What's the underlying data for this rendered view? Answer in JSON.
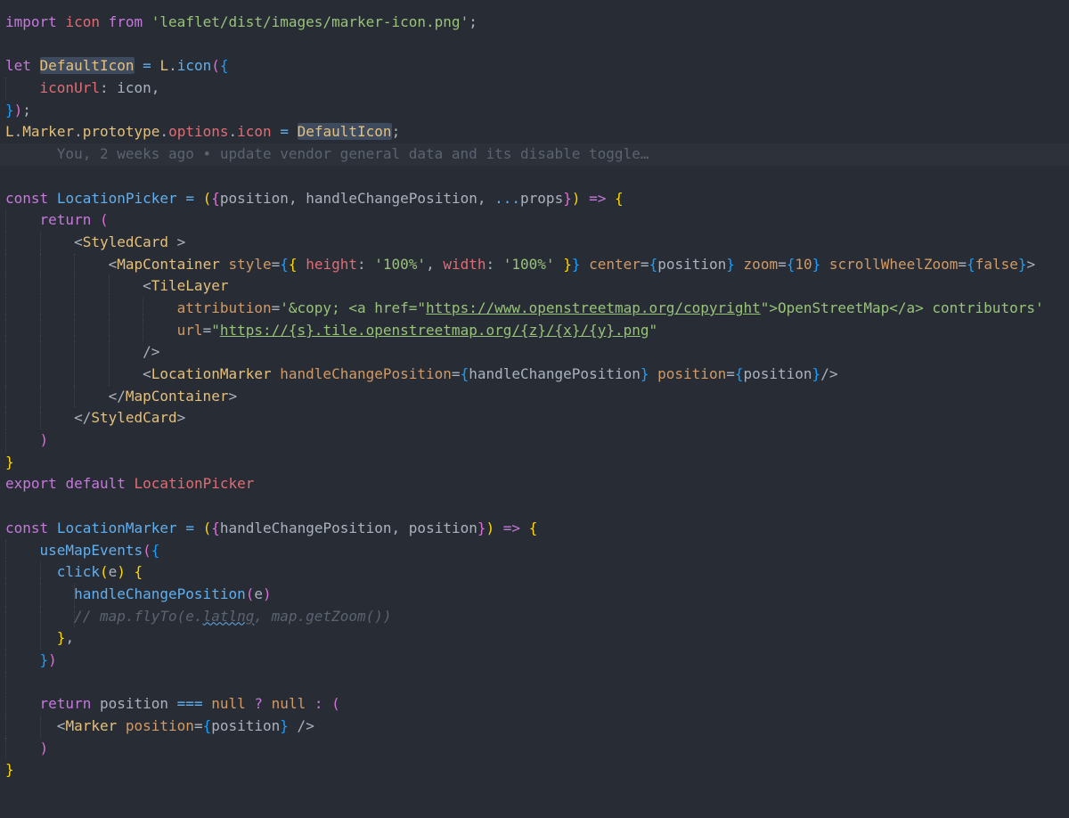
{
  "theme": {
    "background": "#282c34",
    "keyword": "#c678dd",
    "string": "#98c379",
    "function": "#61afef",
    "variable": "#e06c75",
    "type": "#e5c07b",
    "number": "#d19a66",
    "punctuation": "#abb2bf",
    "comment": "#5c6370",
    "bracket_yellow": "#ffd700",
    "bracket_purple": "#da70d6",
    "bracket_blue": "#179fff"
  },
  "code": {
    "lines": [
      {
        "indent": 0,
        "tokens": [
          {
            "t": "import",
            "c": "keyword"
          },
          {
            "t": " "
          },
          {
            "t": "icon",
            "c": "variable"
          },
          {
            "t": " "
          },
          {
            "t": "from",
            "c": "keyword"
          },
          {
            "t": " "
          },
          {
            "t": "'leaflet/dist/images/marker-icon.png'",
            "c": "string"
          },
          {
            "t": ";",
            "c": "punctuation"
          }
        ]
      },
      {
        "indent": 0,
        "tokens": []
      },
      {
        "indent": 0,
        "tokens": [
          {
            "t": "let",
            "c": "keyword"
          },
          {
            "t": " "
          },
          {
            "t": "DefaultIcon",
            "c": "type",
            "sel": true
          },
          {
            "t": " "
          },
          {
            "t": "=",
            "c": "function"
          },
          {
            "t": " "
          },
          {
            "t": "L",
            "c": "type"
          },
          {
            "t": ".",
            "c": "punctuation"
          },
          {
            "t": "icon",
            "c": "function"
          },
          {
            "t": "(",
            "c": "bracket_purple"
          },
          {
            "t": "{",
            "c": "bracket_blue"
          }
        ]
      },
      {
        "indent": 1,
        "tokens": [
          {
            "t": "    "
          },
          {
            "t": "iconUrl",
            "c": "variable"
          },
          {
            "t": ": ",
            "c": "punctuation"
          },
          {
            "t": "icon",
            "c": "punctuation"
          },
          {
            "t": ",",
            "c": "punctuation"
          }
        ]
      },
      {
        "indent": 0,
        "tokens": [
          {
            "t": "}",
            "c": "bracket_blue"
          },
          {
            "t": ")",
            "c": "bracket_purple"
          },
          {
            "t": ";",
            "c": "punctuation"
          }
        ]
      },
      {
        "indent": 0,
        "tokens": [
          {
            "t": "L",
            "c": "type"
          },
          {
            "t": ".",
            "c": "punctuation"
          },
          {
            "t": "Marker",
            "c": "type"
          },
          {
            "t": ".",
            "c": "punctuation"
          },
          {
            "t": "prototype",
            "c": "type"
          },
          {
            "t": ".",
            "c": "punctuation"
          },
          {
            "t": "options",
            "c": "variable"
          },
          {
            "t": ".",
            "c": "punctuation"
          },
          {
            "t": "icon",
            "c": "variable"
          },
          {
            "t": " "
          },
          {
            "t": "=",
            "c": "function"
          },
          {
            "t": " "
          },
          {
            "t": "DefaultIcon",
            "c": "type",
            "sel": true
          },
          {
            "t": ";",
            "c": "punctuation"
          }
        ]
      },
      {
        "indent": 0,
        "blame": true,
        "tokens": [
          {
            "t": "      "
          },
          {
            "t": "You, 2 weeks ago • update vendor general data and its disable toggle…",
            "c": "comment"
          }
        ]
      },
      {
        "indent": 0,
        "tokens": []
      },
      {
        "indent": 0,
        "tokens": [
          {
            "t": "const",
            "c": "keyword"
          },
          {
            "t": " "
          },
          {
            "t": "LocationPicker",
            "c": "function"
          },
          {
            "t": " "
          },
          {
            "t": "=",
            "c": "function"
          },
          {
            "t": " "
          },
          {
            "t": "(",
            "c": "bracket_yellow"
          },
          {
            "t": "{",
            "c": "bracket_purple"
          },
          {
            "t": "position",
            "c": "punctuation"
          },
          {
            "t": ", ",
            "c": "punctuation"
          },
          {
            "t": "handleChangePosition",
            "c": "punctuation"
          },
          {
            "t": ", ",
            "c": "punctuation"
          },
          {
            "t": "...",
            "c": "function"
          },
          {
            "t": "props",
            "c": "punctuation"
          },
          {
            "t": "}",
            "c": "bracket_purple"
          },
          {
            "t": ")",
            "c": "bracket_yellow"
          },
          {
            "t": " "
          },
          {
            "t": "=>",
            "c": "keyword"
          },
          {
            "t": " "
          },
          {
            "t": "{",
            "c": "bracket_yellow"
          }
        ]
      },
      {
        "indent": 1,
        "tokens": [
          {
            "t": "    "
          },
          {
            "t": "return",
            "c": "keyword"
          },
          {
            "t": " "
          },
          {
            "t": "(",
            "c": "bracket_purple"
          }
        ]
      },
      {
        "indent": 2,
        "tokens": [
          {
            "t": "        "
          },
          {
            "t": "<",
            "c": "punctuation"
          },
          {
            "t": "StyledCard",
            "c": "type"
          },
          {
            "t": " >",
            "c": "punctuation"
          }
        ]
      },
      {
        "indent": 3,
        "tokens": [
          {
            "t": "            "
          },
          {
            "t": "<",
            "c": "punctuation"
          },
          {
            "t": "MapContainer",
            "c": "type"
          },
          {
            "t": " "
          },
          {
            "t": "style",
            "c": "number"
          },
          {
            "t": "=",
            "c": "punctuation"
          },
          {
            "t": "{",
            "c": "bracket_blue"
          },
          {
            "t": "{",
            "c": "bracket_yellow"
          },
          {
            "t": " "
          },
          {
            "t": "height",
            "c": "variable"
          },
          {
            "t": ": ",
            "c": "punctuation"
          },
          {
            "t": "'100%'",
            "c": "string"
          },
          {
            "t": ", ",
            "c": "punctuation"
          },
          {
            "t": "width",
            "c": "variable"
          },
          {
            "t": ": ",
            "c": "punctuation"
          },
          {
            "t": "'100%'",
            "c": "string"
          },
          {
            "t": " "
          },
          {
            "t": "}",
            "c": "bracket_yellow"
          },
          {
            "t": "}",
            "c": "bracket_blue"
          },
          {
            "t": " "
          },
          {
            "t": "center",
            "c": "number"
          },
          {
            "t": "=",
            "c": "punctuation"
          },
          {
            "t": "{",
            "c": "bracket_blue"
          },
          {
            "t": "position",
            "c": "punctuation"
          },
          {
            "t": "}",
            "c": "bracket_blue"
          },
          {
            "t": " "
          },
          {
            "t": "zoom",
            "c": "number"
          },
          {
            "t": "=",
            "c": "punctuation"
          },
          {
            "t": "{",
            "c": "bracket_blue"
          },
          {
            "t": "10",
            "c": "number"
          },
          {
            "t": "}",
            "c": "bracket_blue"
          },
          {
            "t": " "
          },
          {
            "t": "scrollWheelZoom",
            "c": "number"
          },
          {
            "t": "=",
            "c": "punctuation"
          },
          {
            "t": "{",
            "c": "bracket_blue"
          },
          {
            "t": "false",
            "c": "number"
          },
          {
            "t": "}",
            "c": "bracket_blue"
          },
          {
            "t": ">",
            "c": "punctuation"
          }
        ]
      },
      {
        "indent": 4,
        "tokens": [
          {
            "t": "                "
          },
          {
            "t": "<",
            "c": "punctuation"
          },
          {
            "t": "TileLayer",
            "c": "type"
          }
        ]
      },
      {
        "indent": 5,
        "tokens": [
          {
            "t": "                    "
          },
          {
            "t": "attribution",
            "c": "number"
          },
          {
            "t": "=",
            "c": "punctuation"
          },
          {
            "t": "'&copy; <a href=\"",
            "c": "string"
          },
          {
            "t": "https://www.openstreetmap.org/copyright",
            "c": "string",
            "ul": true
          },
          {
            "t": "\">OpenStreetMap</a> contributors'",
            "c": "string"
          }
        ]
      },
      {
        "indent": 5,
        "tokens": [
          {
            "t": "                    "
          },
          {
            "t": "url",
            "c": "number"
          },
          {
            "t": "=",
            "c": "punctuation"
          },
          {
            "t": "\"",
            "c": "string"
          },
          {
            "t": "https://{s}.tile.openstreetmap.org/{z}/{x}/{y}.png",
            "c": "string",
            "ul": true
          },
          {
            "t": "\"",
            "c": "string"
          }
        ]
      },
      {
        "indent": 4,
        "tokens": [
          {
            "t": "                "
          },
          {
            "t": "/>",
            "c": "punctuation"
          }
        ]
      },
      {
        "indent": 4,
        "tokens": [
          {
            "t": "                "
          },
          {
            "t": "<",
            "c": "punctuation"
          },
          {
            "t": "LocationMarker",
            "c": "type"
          },
          {
            "t": " "
          },
          {
            "t": "handleChangePosition",
            "c": "number"
          },
          {
            "t": "=",
            "c": "punctuation"
          },
          {
            "t": "{",
            "c": "bracket_blue"
          },
          {
            "t": "handleChangePosition",
            "c": "punctuation"
          },
          {
            "t": "}",
            "c": "bracket_blue"
          },
          {
            "t": " "
          },
          {
            "t": "position",
            "c": "number"
          },
          {
            "t": "=",
            "c": "punctuation"
          },
          {
            "t": "{",
            "c": "bracket_blue"
          },
          {
            "t": "position",
            "c": "punctuation"
          },
          {
            "t": "}",
            "c": "bracket_blue"
          },
          {
            "t": "/>",
            "c": "punctuation"
          }
        ]
      },
      {
        "indent": 3,
        "tokens": [
          {
            "t": "            "
          },
          {
            "t": "</",
            "c": "punctuation"
          },
          {
            "t": "MapContainer",
            "c": "type"
          },
          {
            "t": ">",
            "c": "punctuation"
          }
        ]
      },
      {
        "indent": 2,
        "tokens": [
          {
            "t": "        "
          },
          {
            "t": "</",
            "c": "punctuation"
          },
          {
            "t": "StyledCard",
            "c": "type"
          },
          {
            "t": ">",
            "c": "punctuation"
          }
        ]
      },
      {
        "indent": 1,
        "tokens": [
          {
            "t": "    "
          },
          {
            "t": ")",
            "c": "bracket_purple"
          }
        ]
      },
      {
        "indent": 0,
        "tokens": [
          {
            "t": "}",
            "c": "bracket_yellow"
          }
        ]
      },
      {
        "indent": 0,
        "tokens": [
          {
            "t": "export",
            "c": "keyword"
          },
          {
            "t": " "
          },
          {
            "t": "default",
            "c": "keyword"
          },
          {
            "t": " "
          },
          {
            "t": "LocationPicker",
            "c": "variable"
          }
        ]
      },
      {
        "indent": 0,
        "tokens": []
      },
      {
        "indent": 0,
        "tokens": [
          {
            "t": "const",
            "c": "keyword"
          },
          {
            "t": " "
          },
          {
            "t": "LocationMarker",
            "c": "function"
          },
          {
            "t": " "
          },
          {
            "t": "=",
            "c": "function"
          },
          {
            "t": " "
          },
          {
            "t": "(",
            "c": "bracket_yellow"
          },
          {
            "t": "{",
            "c": "bracket_purple"
          },
          {
            "t": "handleChangePosition",
            "c": "punctuation"
          },
          {
            "t": ", ",
            "c": "punctuation"
          },
          {
            "t": "position",
            "c": "punctuation"
          },
          {
            "t": "}",
            "c": "bracket_purple"
          },
          {
            "t": ")",
            "c": "bracket_yellow"
          },
          {
            "t": " "
          },
          {
            "t": "=>",
            "c": "keyword"
          },
          {
            "t": " "
          },
          {
            "t": "{",
            "c": "bracket_yellow"
          }
        ]
      },
      {
        "indent": 1,
        "tokens": [
          {
            "t": "    "
          },
          {
            "t": "useMapEvents",
            "c": "function"
          },
          {
            "t": "(",
            "c": "bracket_purple"
          },
          {
            "t": "{",
            "c": "bracket_blue"
          }
        ]
      },
      {
        "indent": 2,
        "tokens": [
          {
            "t": "      "
          },
          {
            "t": "click",
            "c": "function"
          },
          {
            "t": "(",
            "c": "bracket_yellow"
          },
          {
            "t": "e",
            "c": "punctuation"
          },
          {
            "t": ")",
            "c": "bracket_yellow"
          },
          {
            "t": " "
          },
          {
            "t": "{",
            "c": "bracket_yellow"
          }
        ]
      },
      {
        "indent": 3,
        "tokens": [
          {
            "t": "        "
          },
          {
            "t": "handleChangePosition",
            "c": "function"
          },
          {
            "t": "(",
            "c": "bracket_purple"
          },
          {
            "t": "e",
            "c": "punctuation"
          },
          {
            "t": ")",
            "c": "bracket_purple"
          }
        ]
      },
      {
        "indent": 3,
        "tokens": [
          {
            "t": "        "
          },
          {
            "t": "// map.flyTo(e.",
            "c": "comment",
            "italic": true
          },
          {
            "t": "latlng",
            "c": "comment",
            "italic": true,
            "squiggle": true
          },
          {
            "t": ", map.getZoom())",
            "c": "comment",
            "italic": true
          }
        ]
      },
      {
        "indent": 2,
        "tokens": [
          {
            "t": "      "
          },
          {
            "t": "}",
            "c": "bracket_yellow"
          },
          {
            "t": ",",
            "c": "punctuation"
          }
        ]
      },
      {
        "indent": 1,
        "tokens": [
          {
            "t": "    "
          },
          {
            "t": "}",
            "c": "bracket_blue"
          },
          {
            "t": ")",
            "c": "bracket_purple"
          }
        ]
      },
      {
        "indent": 1,
        "tokens": []
      },
      {
        "indent": 1,
        "tokens": [
          {
            "t": "    "
          },
          {
            "t": "return",
            "c": "keyword"
          },
          {
            "t": " "
          },
          {
            "t": "position",
            "c": "punctuation"
          },
          {
            "t": " "
          },
          {
            "t": "===",
            "c": "function"
          },
          {
            "t": " "
          },
          {
            "t": "null",
            "c": "number"
          },
          {
            "t": " "
          },
          {
            "t": "?",
            "c": "keyword"
          },
          {
            "t": " "
          },
          {
            "t": "null",
            "c": "number"
          },
          {
            "t": " "
          },
          {
            "t": ":",
            "c": "keyword"
          },
          {
            "t": " "
          },
          {
            "t": "(",
            "c": "bracket_purple"
          }
        ]
      },
      {
        "indent": 2,
        "tokens": [
          {
            "t": "      "
          },
          {
            "t": "<",
            "c": "punctuation"
          },
          {
            "t": "Marker",
            "c": "type"
          },
          {
            "t": " "
          },
          {
            "t": "position",
            "c": "number"
          },
          {
            "t": "=",
            "c": "punctuation"
          },
          {
            "t": "{",
            "c": "bracket_blue"
          },
          {
            "t": "position",
            "c": "punctuation"
          },
          {
            "t": "}",
            "c": "bracket_blue"
          },
          {
            "t": " />",
            "c": "punctuation"
          }
        ]
      },
      {
        "indent": 1,
        "tokens": [
          {
            "t": "    "
          },
          {
            "t": ")",
            "c": "bracket_purple"
          }
        ]
      },
      {
        "indent": 0,
        "tokens": [
          {
            "t": "}",
            "c": "bracket_yellow"
          }
        ]
      }
    ]
  }
}
